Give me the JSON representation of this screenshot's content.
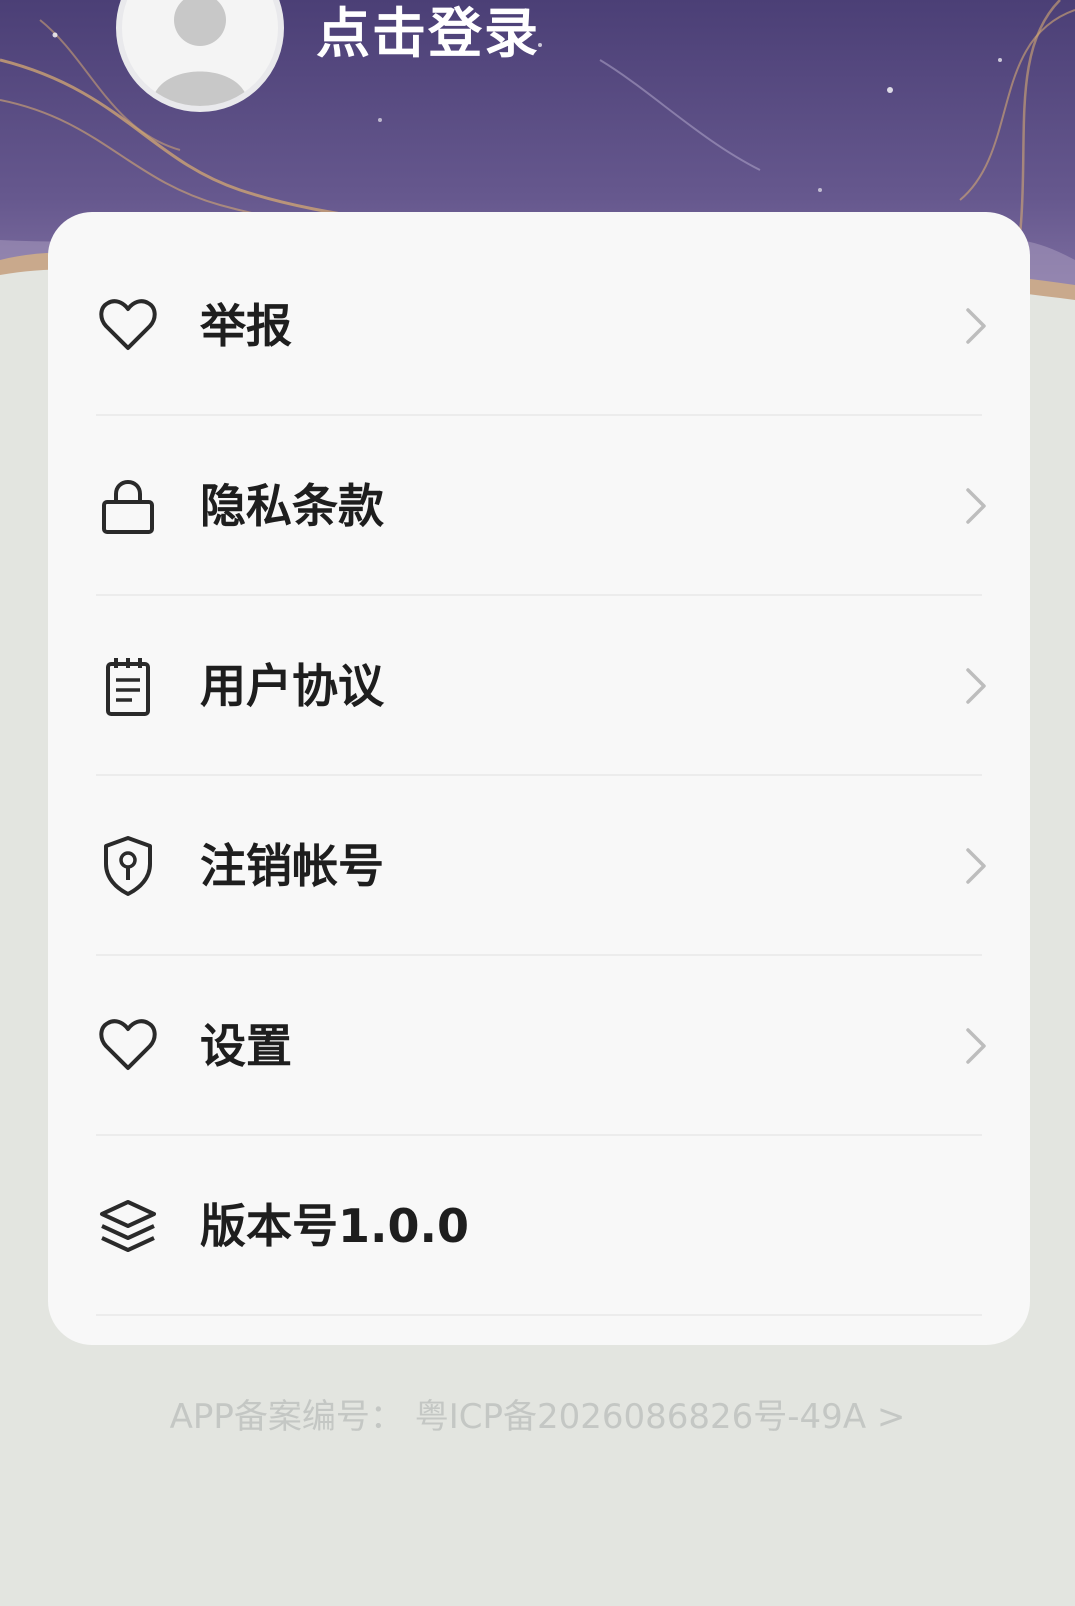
{
  "header": {
    "login_label": "点击登录"
  },
  "menu": {
    "items": [
      {
        "label": "举报",
        "icon": "heart-icon",
        "has_arrow": true
      },
      {
        "label": "隐私条款",
        "icon": "lock-icon",
        "has_arrow": true
      },
      {
        "label": "用户协议",
        "icon": "notepad-icon",
        "has_arrow": true
      },
      {
        "label": "注销帐号",
        "icon": "shield-keyhole-icon",
        "has_arrow": true
      },
      {
        "label": "设置",
        "icon": "heart-icon",
        "has_arrow": true
      },
      {
        "label": "版本号1.0.0",
        "icon": "layers-icon",
        "has_arrow": false
      }
    ]
  },
  "footer": {
    "icp_text": "APP备案编号：  粤ICP备2026086826号-49A >"
  },
  "colors": {
    "header_purple": "#5a4d80",
    "page_background": "#e3e5e0",
    "card_background": "#f8f8f8",
    "text_primary": "#1e1e1e",
    "text_muted": "#c4c7c4"
  }
}
